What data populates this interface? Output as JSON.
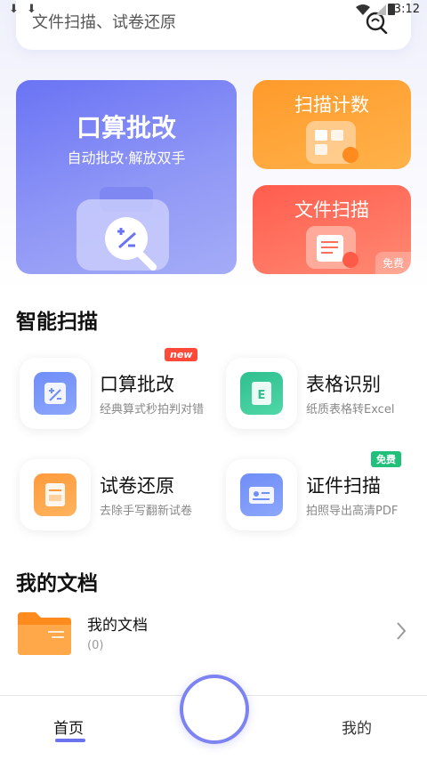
{
  "status_bar": {
    "time": "3:12",
    "download_icons": [
      "download-icon",
      "download-icon"
    ]
  },
  "search": {
    "placeholder": "文件扫描、试卷还原",
    "icon": "search-icon"
  },
  "hero": {
    "title": "口算批改",
    "subtitle": "自动批改·解放双手"
  },
  "cards": {
    "scan_count": {
      "label": "扫描计数"
    },
    "file_scan": {
      "label": "文件扫描",
      "badge": "免费"
    }
  },
  "smart_scan": {
    "title": "智能扫描",
    "items": [
      {
        "name": "口算批改",
        "desc": "经典算式秒拍判对错",
        "badge": "new",
        "color": "#6f8ef7"
      },
      {
        "name": "表格识别",
        "desc": "纸质表格转Excel",
        "badge": "",
        "color": "#2fbf8f"
      },
      {
        "name": "试卷还原",
        "desc": "去除手写翻新试卷",
        "badge": "",
        "color": "#ff9a3c"
      },
      {
        "name": "证件扫描",
        "desc": "拍照导出高清PDF",
        "badge": "免费",
        "color": "#6f8ef7"
      }
    ]
  },
  "docs": {
    "title": "我的文档",
    "item_name": "我的文档",
    "item_count": "(0)"
  },
  "nav": {
    "home": "首页",
    "mine": "我的"
  },
  "colors": {
    "accent": "#6b72f0",
    "orange": "#ff9a2b",
    "red": "#ff5c4d",
    "new_badge": "#ff4a3a",
    "free_badge": "#20c07a"
  }
}
